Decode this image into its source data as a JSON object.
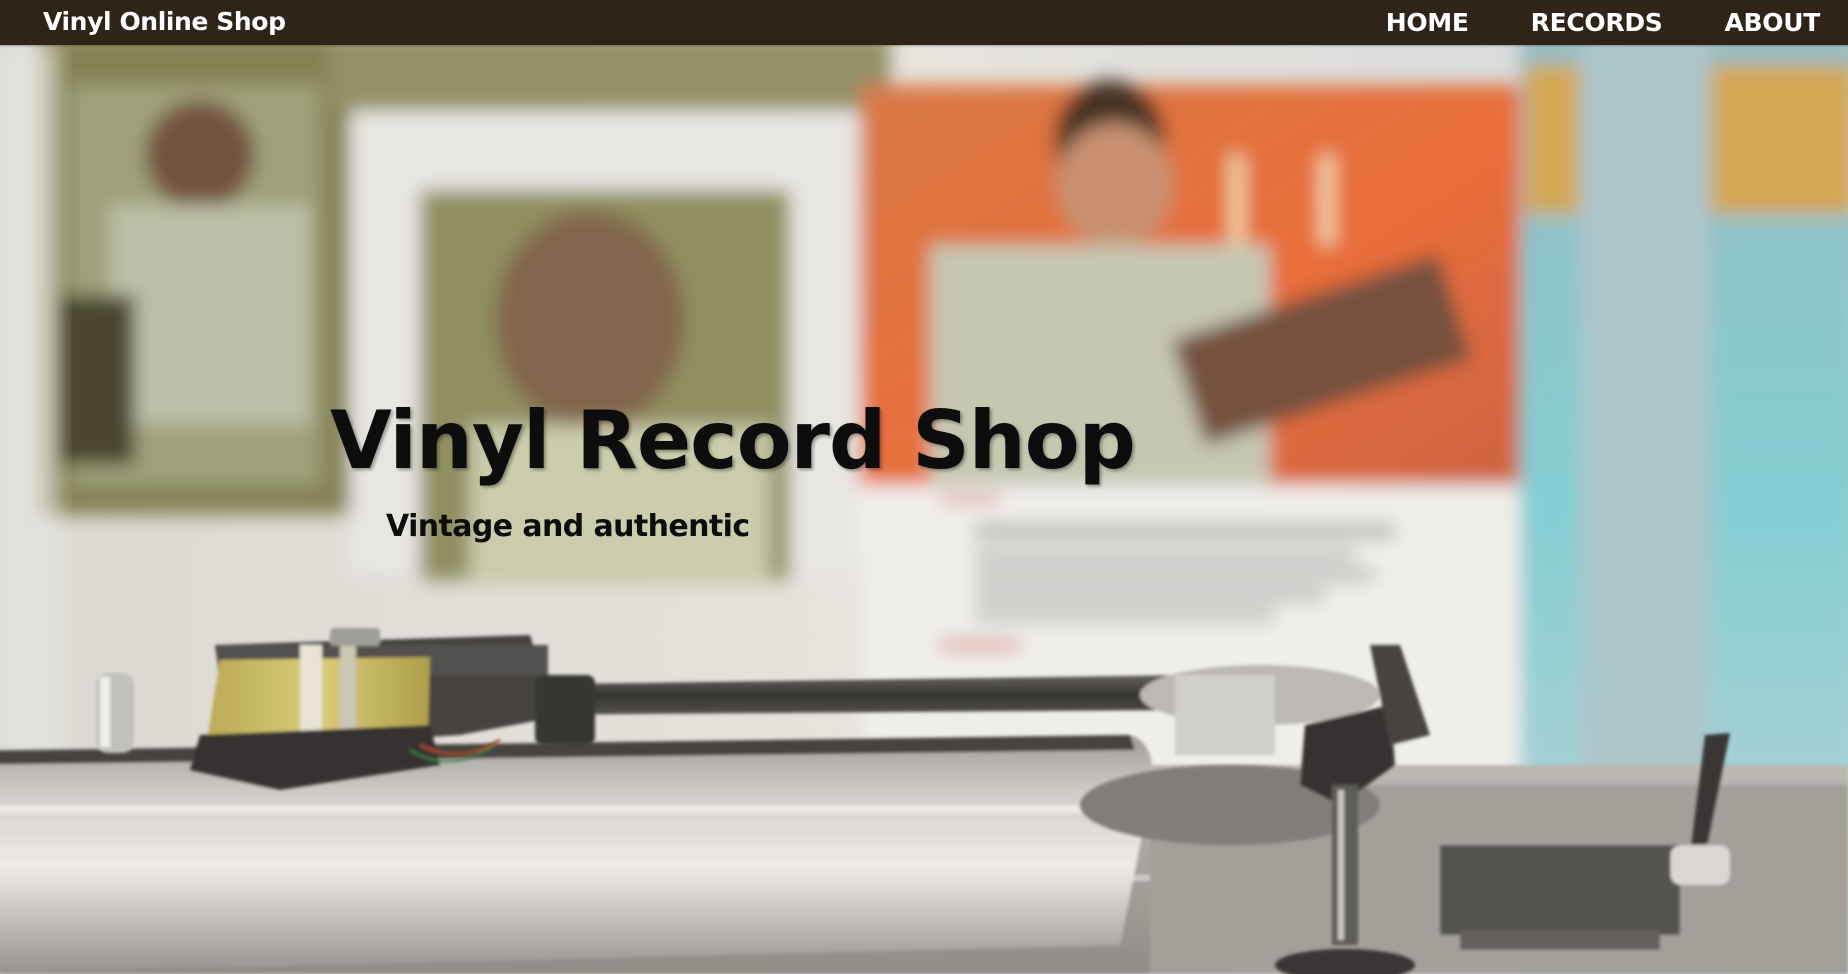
{
  "navbar": {
    "brand": "Vinyl Online Shop",
    "links": [
      {
        "label": "HOME"
      },
      {
        "label": "RECORDS"
      },
      {
        "label": "ABOUT"
      }
    ]
  },
  "hero": {
    "title": "Vinyl Record Shop",
    "subtitle": "Vintage and authentic",
    "background": "turntable-photo"
  },
  "colors": {
    "navbar_background": "#2e2417",
    "nav_text": "#ffffff",
    "hero_text": "#0d0d0d"
  }
}
